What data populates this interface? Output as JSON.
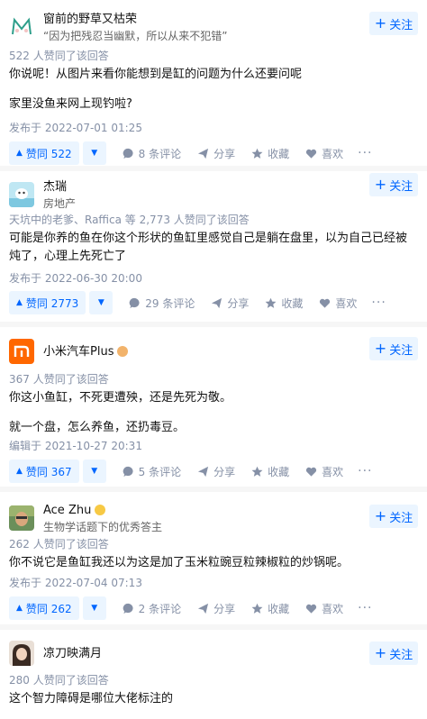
{
  "follow_label": "关注",
  "answers": [
    {
      "author": "窗前的野草又枯荣",
      "headline": "“因为把残忍当幽默，所以从来不犯错”",
      "votes_text": "522 人赞同了该回答",
      "paragraphs": [
        "你说呢！从图片来看你能想到是缸的问题为什么还要问呢",
        "家里没鱼来网上现钓啦?"
      ],
      "time": "发布于 2022-07-01 01:25",
      "vote_label": "赞同 522",
      "comments": "8 条评论"
    },
    {
      "author": "杰瑞",
      "headline": "房地产",
      "votes_text": "天坑中的老爹、Raffica 等 2,773 人赞同了该回答",
      "paragraphs": [
        "可能是你养的鱼在你这个形状的鱼缸里感觉自己是躺在盘里，以为自己已经被炖了，心理上先死亡了"
      ],
      "time": "发布于 2022-06-30 20:00",
      "vote_label": "赞同 2773",
      "comments": "29 条评论"
    },
    {
      "author": "小米汽车Plus",
      "headline": "",
      "votes_text": "367 人赞同了该回答",
      "paragraphs": [
        "你这小鱼缸，不死更遭殃，还是先死为敬。",
        "就一个盘，怎么养鱼，还扔毒豆。"
      ],
      "time": "编辑于 2021-10-27 20:31",
      "vote_label": "赞同 367",
      "comments": "5 条评论"
    },
    {
      "author": "Ace Zhu",
      "headline": "生物学话题下的优秀答主",
      "votes_text": "262 人赞同了该回答",
      "paragraphs": [
        "你不说它是鱼缸我还以为这是加了玉米粒豌豆粒辣椒粒的炒锅呢。"
      ],
      "time": "发布于 2022-07-04 07:13",
      "vote_label": "赞同 262",
      "comments": "2 条评论"
    },
    {
      "author": "凉刀映满月",
      "headline": "",
      "votes_text": "280 人赞同了该回答",
      "paragraphs": [
        "这个智力障碍是哪位大佬标注的"
      ]
    }
  ],
  "action_labels": {
    "share": "分享",
    "favorite": "收藏",
    "like": "喜欢",
    "more": "···"
  },
  "icons": {
    "vote_up": "triangle-up-icon",
    "vote_down": "triangle-down-icon",
    "comment": "comment-icon",
    "share": "share-icon",
    "favorite": "star-icon",
    "like": "heart-icon",
    "more": "more-icon",
    "follow": "plus-icon"
  },
  "colors": {
    "accent": "#0066ff",
    "accent_bg": "#ebf5ff",
    "meta": "#8590a6",
    "xiaomi": "#ff6700"
  }
}
